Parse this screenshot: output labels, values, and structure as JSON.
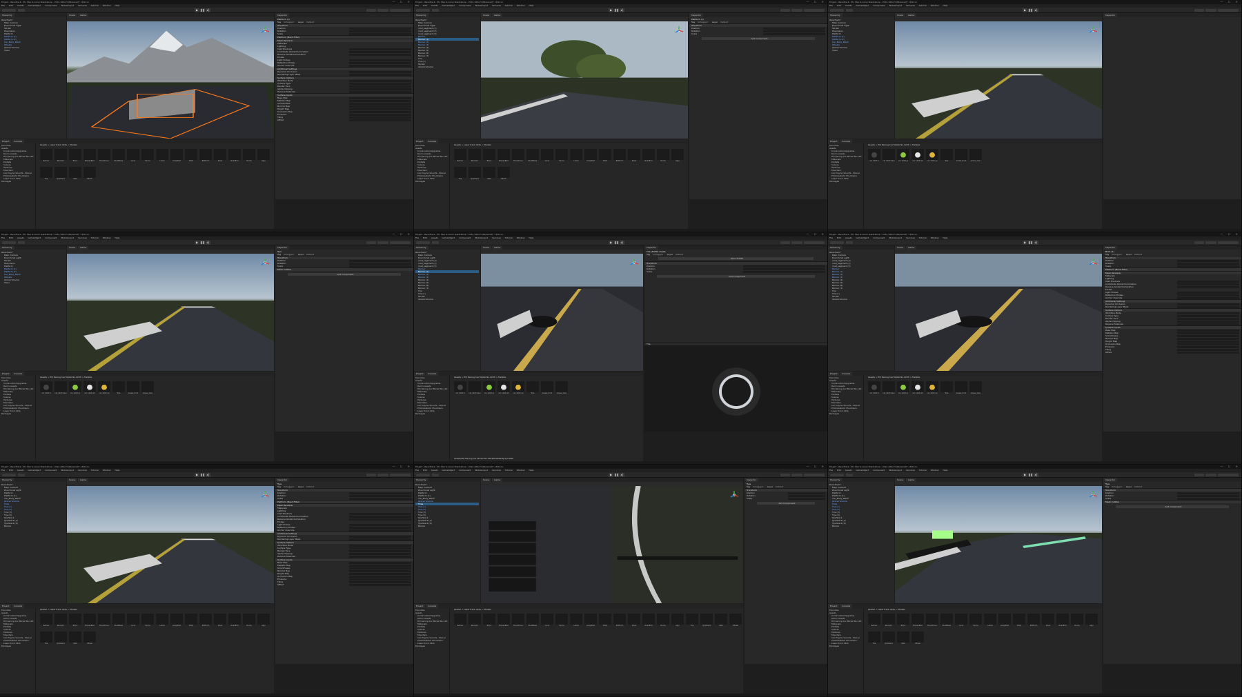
{
  "app": {
    "window_title": "Project - RaceTrack - PC, Mac & Linux Standalone - Unity 2022.3 (Personal)* <DX11>",
    "window_controls": "— ☐ ✕",
    "menu": [
      "File",
      "Edit",
      "Assets",
      "GameObject",
      "Component",
      "Mobile Input",
      "Services",
      "Tutorial",
      "Window",
      "Help"
    ]
  },
  "tabs": {
    "hierarchy": "Hierarchy",
    "scene": "Scene",
    "game": "Game",
    "inspector": "Inspector",
    "project": "Project",
    "console": "Console",
    "asset_store": "Asset Store"
  },
  "hierarchy": {
    "root": "RaceTrack*",
    "items_a": [
      "Main Camera",
      "Directional Light",
      "Terrain",
      "Mountains",
      "Platform",
      "Platform (1)",
      "Platform (2)",
      "Car_Body_Mesh",
      "Wheels",
      "Global Volume",
      "Trees"
    ],
    "items_b": [
      "Main Camera",
      "Directional Light",
      "road_segment (1)",
      "road_segment (2)",
      "road_segment (3)",
      "Barrier",
      "Barrier (1)",
      "Barrier (2)",
      "Barrier (3)",
      "Barrier (4)",
      "Barrier (5)",
      "Barrier (6)",
      "Barrier (7)",
      "Tire",
      "Tire (1)",
      "Terrain",
      "Global Volume"
    ],
    "items_c": [
      "Main Camera",
      "Directional Light",
      "Platform",
      "Platform (1)",
      "Car_Body_Mesh",
      "Global Volume",
      "Tires",
      "Tire (1)",
      "Tire (2)",
      "Tire (3)",
      "Tire (4)",
      "TyreStack",
      "TyreStack (1)",
      "TyreStack (2)",
      "Barrier"
    ]
  },
  "inspector": {
    "object_a": "Platform (1)",
    "object_b": "Tyre",
    "object_c": "Tire (Prefab Asset)",
    "object_d": "Bush (1)",
    "static": "Static",
    "tag": "Tag",
    "tag_value": "Untagged",
    "layer": "Layer",
    "layer_value": "Default",
    "sections": {
      "transform": "Transform",
      "mesh_filter": "Platform (Mesh Filter)",
      "mesh_renderer": "Mesh Renderer",
      "mesh_collider": "Mesh Collider",
      "materials": "Materials",
      "lighting": "Lighting",
      "probes": "Probes",
      "additional": "Additional Settings",
      "surface_options": "Surface Options",
      "surface_inputs": "Surface Inputs"
    },
    "transform_labels": [
      "Position",
      "Rotation",
      "Scale"
    ],
    "row_labels": [
      "Cast Shadows",
      "Contribute Global Illumination",
      "Receive Global Illumination",
      "Light Probes",
      "Reflection Probes",
      "Anchor Override",
      "Dynamic Occlusion",
      "Rendering Layer Mask",
      "Workflow Mode",
      "Surface Type",
      "Render Face",
      "Alpha Clipping",
      "Receive Shadows",
      "Base Map",
      "Metallic Map",
      "Smoothness",
      "Normal Map",
      "Height Map",
      "Occlusion Map",
      "Emission",
      "Tiling",
      "Offset"
    ],
    "add_component": "Add Component",
    "open_prefab": "Open Prefab",
    "preview_label": "Tire",
    "asset_labels": "Asset Labels",
    "asset_bundle": "AssetBundle",
    "none": "None"
  },
  "project": {
    "tree": [
      "Favorites",
      "Assets",
      "ConstructionUpgrades",
      "Demo Assets",
      "HQ Racing Car Model No.1203",
      "Materials",
      "Prefabs",
      "Scenes",
      "Textures",
      "Mountain",
      "Car Engine Sounds - Stereo",
      "Photorealistic Mountains",
      "Laser track Ukta",
      "Packages"
    ],
    "crumb_models": "Assets > Laser track Ukta > Models",
    "crumb_prefabs": "Assets > HQ Racing Car Model No.1203 > Prefabs",
    "models": [
      "Barrier",
      "Barrier1",
      "Block",
      "BrokenBarr",
      "BrushCone",
      "BuildRoad",
      "Cone",
      "Fence",
      "Lamp",
      "LampPost",
      "Pillar",
      "Platform",
      "Road",
      "RoadEnd",
      "Rocks",
      "Sign",
      "Tire",
      "TyreStack",
      "Wall",
      "Wheel"
    ],
    "prefabs": [
      "car 1203 b",
      "car 1203 blue",
      "car 1203 gr",
      "car 1203 wh",
      "car 1203 ye",
      "Tyre",
      "wheel_front",
      "wheel_rear"
    ],
    "path_bar": "Assets/HQ Racing Car Model No.1203/Prefabs/Tyre.prefab"
  }
}
